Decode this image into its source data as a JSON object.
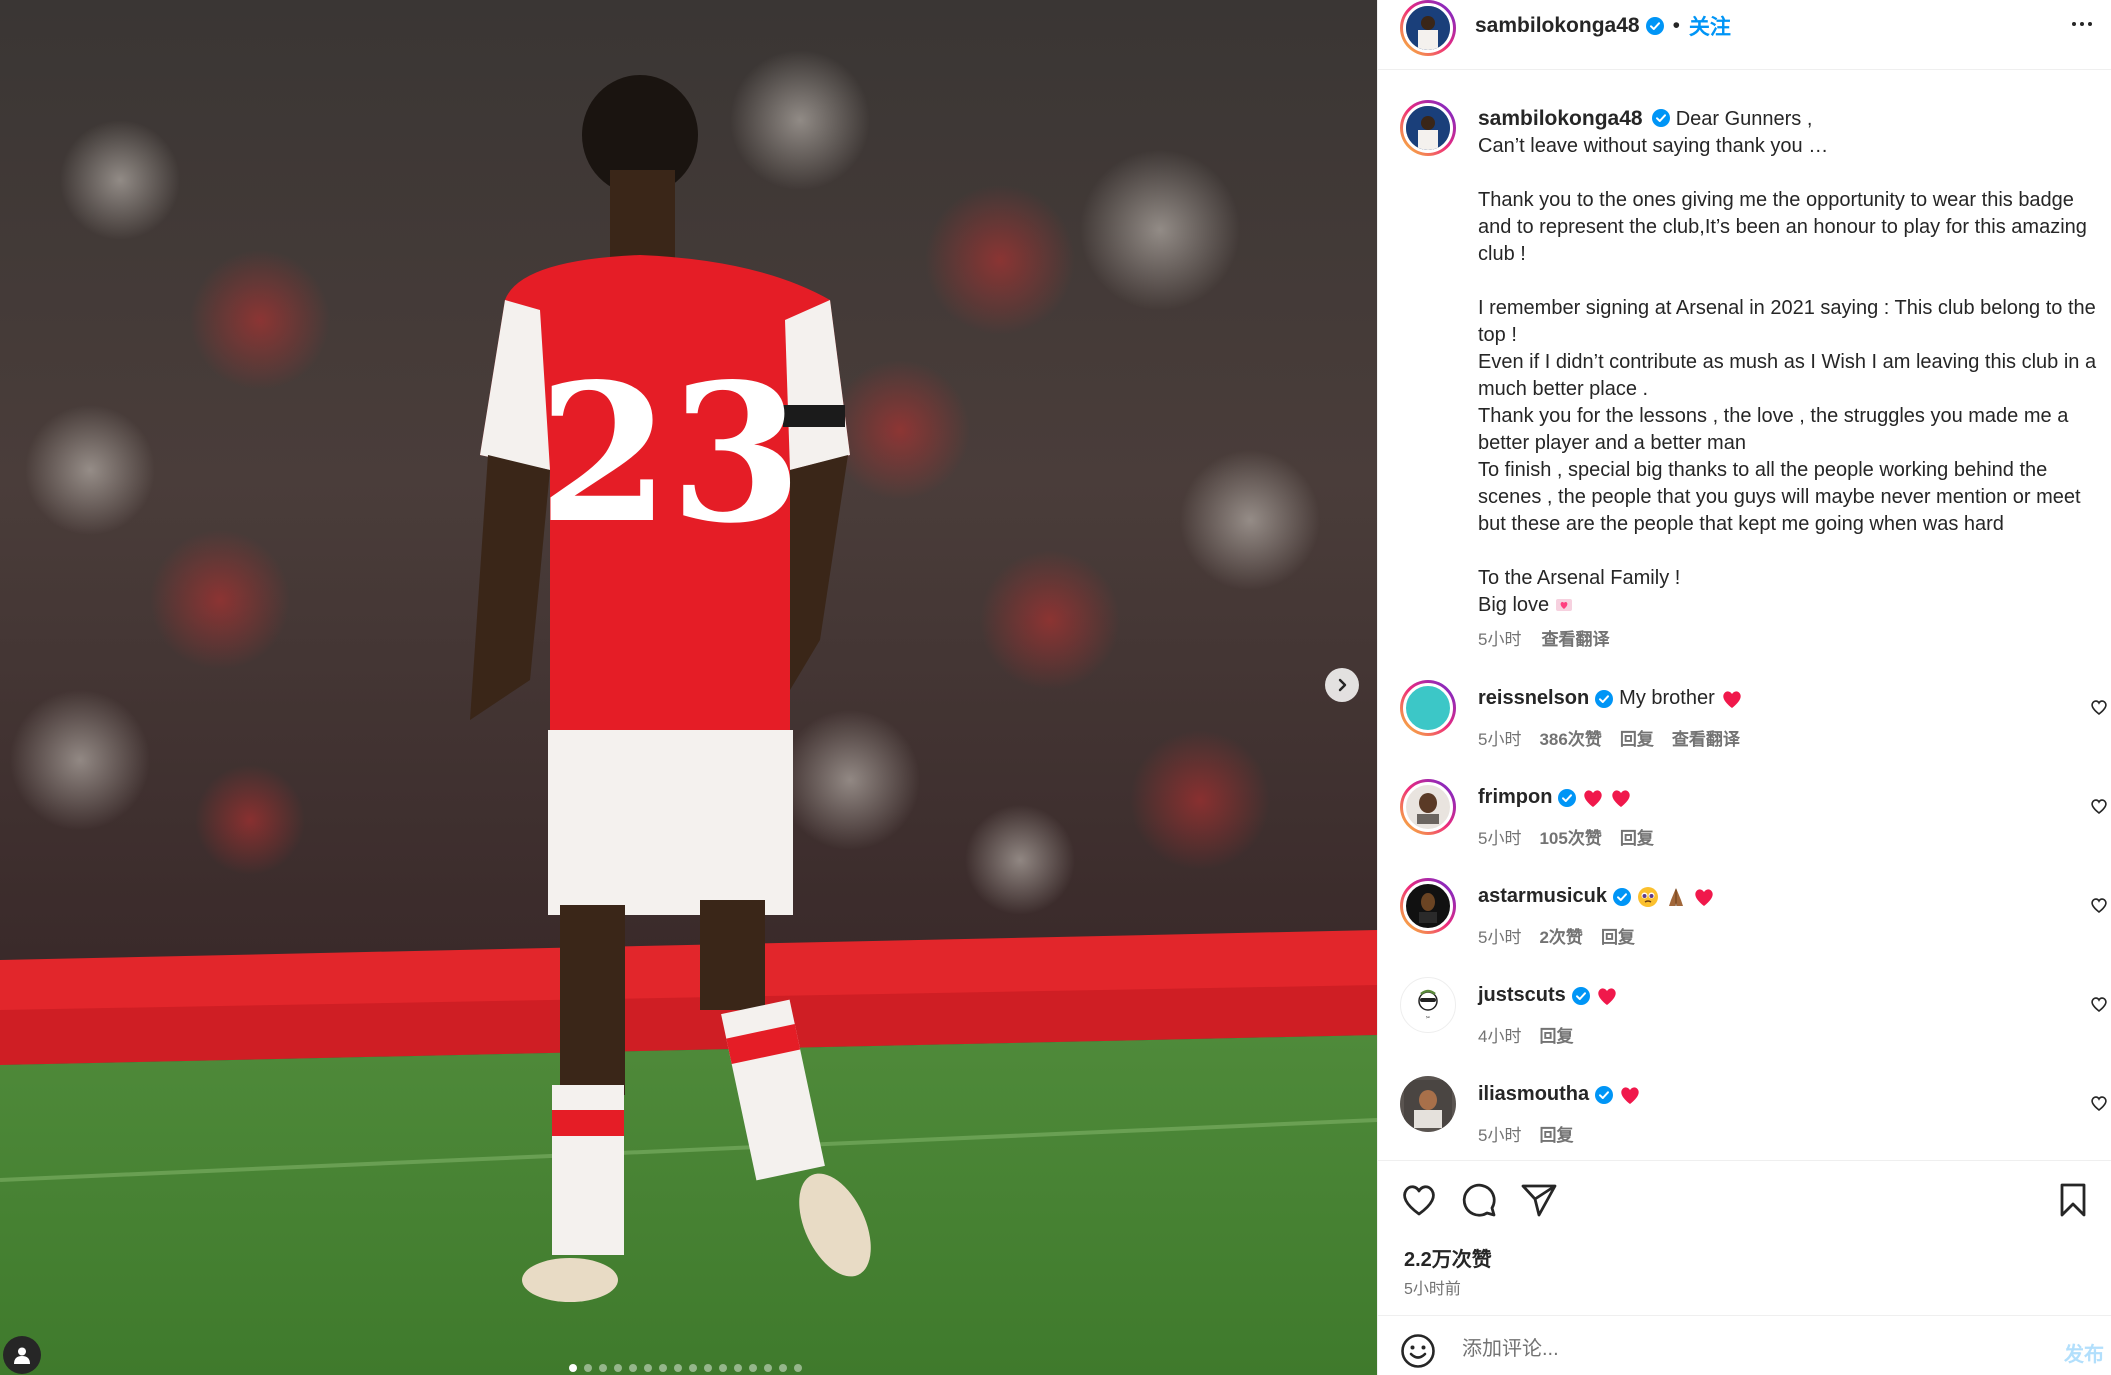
{
  "post": {
    "username": "sambilokonga48",
    "follow_label": "关注",
    "caption_greeting": "Dear Gunners ,",
    "caption_text": "Can’t leave without saying thank you …\n\nThank you to the ones giving me the opportunity to wear this badge and to represent the club,It’s been an honour to play for this amazing club !\n\nI remember signing at Arsenal in 2021 saying : This club belong to the top !\nEven if I didn’t contribute as mush as I Wish I am leaving this club in a much better place .\nThank you for the lessons , the love , the struggles you made me a better player and a better man\nTo finish , special big thanks to all the people working behind the scenes , the people that you guys will maybe never mention or meet but these are the people that kept me going when was hard\n\nTo the Arsenal Family !\nBig love",
    "caption_time": "5小时",
    "caption_translate": "查看翻译",
    "jersey_number": "23",
    "carousel": {
      "total_slides": 16,
      "active_index": 1
    }
  },
  "comments": [
    {
      "username": "reissnelson",
      "text": "My brother",
      "emojis": [
        "red-heart"
      ],
      "time": "5小时",
      "likes": "386次赞",
      "reply": "回复",
      "translate": "查看翻译"
    },
    {
      "username": "frimpon",
      "text": "",
      "emojis": [
        "red-heart",
        "red-heart"
      ],
      "time": "5小时",
      "likes": "105次赞",
      "reply": "回复"
    },
    {
      "username": "astarmusicuk",
      "text": "",
      "emojis": [
        "pleading-face",
        "folded-hands",
        "red-heart"
      ],
      "time": "5小时",
      "likes": "2次赞",
      "reply": "回复"
    },
    {
      "username": "justscuts",
      "text": "",
      "emojis": [
        "red-heart"
      ],
      "time": "4小时",
      "reply": "回复"
    },
    {
      "username": "iliasmoutha",
      "text": "",
      "emojis": [
        "red-heart"
      ],
      "time": "5小时",
      "reply": "回复"
    }
  ],
  "stats": {
    "likes": "2.2万次赞",
    "posted": "5小时前"
  },
  "composer": {
    "placeholder": "添加评论...",
    "post_label": "发布"
  },
  "colors": {
    "accent": "#0095f6",
    "heart": "#ff3040",
    "secondary_text": "#737373"
  }
}
